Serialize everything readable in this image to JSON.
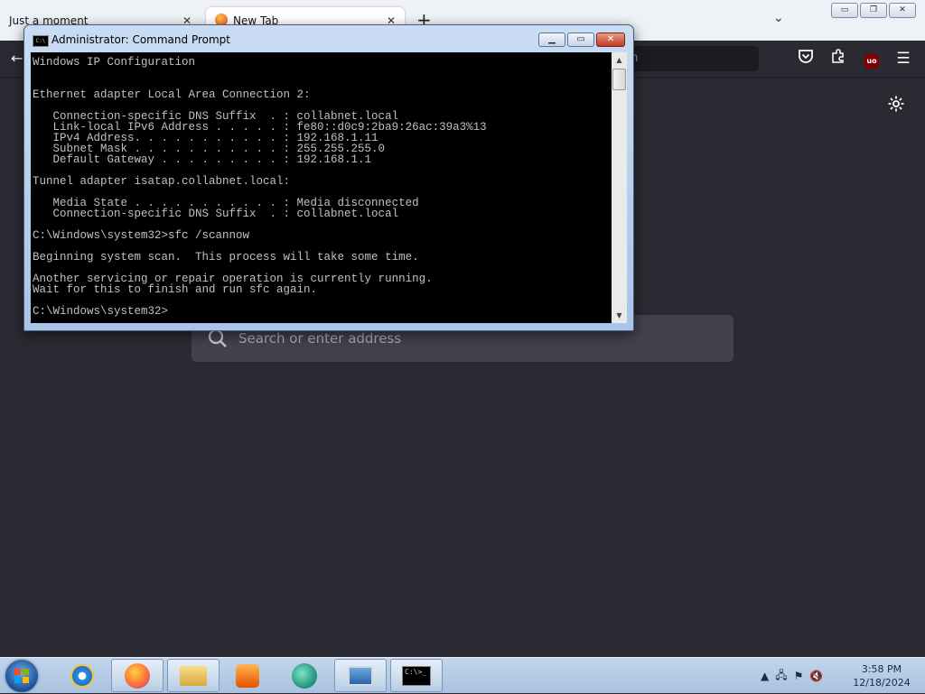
{
  "firefox": {
    "tabs": [
      {
        "title": "Just a moment",
        "close": "✕"
      },
      {
        "title": "New Tab",
        "close": "✕"
      }
    ],
    "new_tab_glyph": "+",
    "tab_list_glyph": "⌄",
    "window_buttons": [
      "▭",
      "❐",
      "✕"
    ],
    "nav": {
      "back_glyph": "←",
      "urlbar_text": "rch",
      "ublock_badge": "uo",
      "menu_glyph": "☰"
    },
    "newtab_search_placeholder": "Search or enter address",
    "icons": [
      "back-arrow-icon",
      "pocket-icon",
      "extensions-puzzle-icon",
      "ublock-origin-icon",
      "hamburger-menu-icon",
      "settings-gear-icon",
      "search-icon"
    ]
  },
  "cmd": {
    "title": "Administrator: Command Prompt",
    "controls": {
      "minimize": "▁",
      "maximize": "▭",
      "close": "✕"
    },
    "scroll_up": "▲",
    "scroll_down": "▼",
    "lines": [
      "Windows IP Configuration",
      "",
      "",
      "Ethernet adapter Local Area Connection 2:",
      "",
      "   Connection-specific DNS Suffix  . : collabnet.local",
      "   Link-local IPv6 Address . . . . . : fe80::d0c9:2ba9:26ac:39a3%13",
      "   IPv4 Address. . . . . . . . . . . : 192.168.1.11",
      "   Subnet Mask . . . . . . . . . . . : 255.255.255.0",
      "   Default Gateway . . . . . . . . . : 192.168.1.1",
      "",
      "Tunnel adapter isatap.collabnet.local:",
      "",
      "   Media State . . . . . . . . . . . : Media disconnected",
      "   Connection-specific DNS Suffix  . : collabnet.local",
      "",
      "C:\\Windows\\system32>sfc /scannow",
      "",
      "Beginning system scan.  This process will take some time.",
      "",
      "Another servicing or repair operation is currently running.",
      "Wait for this to finish and run sfc again.",
      "",
      "C:\\Windows\\system32>"
    ]
  },
  "taskbar": {
    "items": [
      {
        "name": "internet-explorer",
        "icon": "internet-explorer-icon",
        "active": false
      },
      {
        "name": "firefox",
        "icon": "firefox-icon",
        "active": true
      },
      {
        "name": "file-explorer",
        "icon": "folder-icon",
        "active": true
      },
      {
        "name": "media-player",
        "icon": "media-player-icon",
        "active": false
      },
      {
        "name": "chat-app",
        "icon": "chat-bubble-icon",
        "active": false
      },
      {
        "name": "remote-desktop",
        "icon": "monitor-icon",
        "active": true
      },
      {
        "name": "command-prompt",
        "icon": "command-prompt-icon",
        "active": true
      }
    ],
    "cmd_glyph_text": "C:\\>_",
    "tray": {
      "expand_glyph": "▲",
      "network_glyph": "🖧",
      "flag_glyph": "⚑",
      "volume_glyph": "🔇"
    },
    "clock": {
      "time": "3:58 PM",
      "date": "12/18/2024"
    }
  }
}
